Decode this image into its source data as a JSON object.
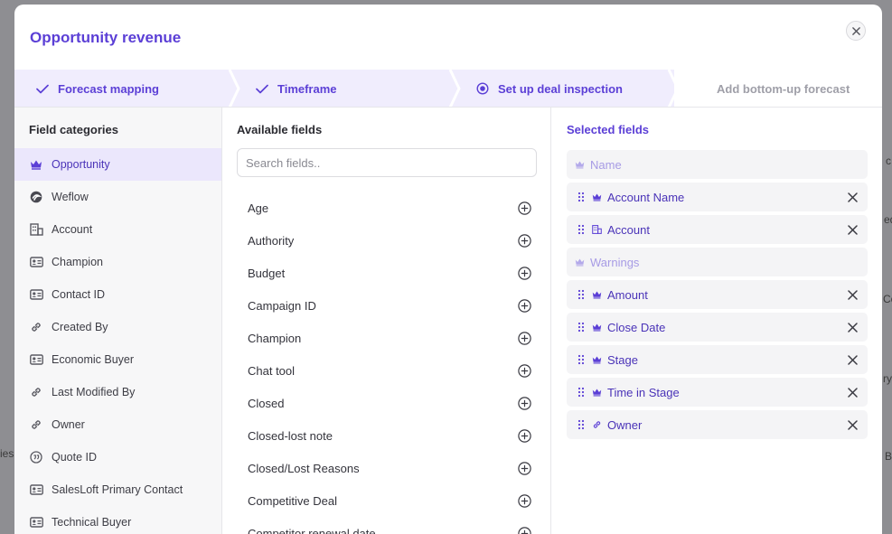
{
  "background": {
    "fragments": [
      "ies",
      "c",
      "ed",
      "Co",
      "ry,",
      "B"
    ]
  },
  "modal": {
    "title": "Opportunity revenue",
    "close_icon": "close-icon"
  },
  "stepper": {
    "steps": [
      {
        "label": "Forecast mapping",
        "state": "done",
        "icon": "check-icon"
      },
      {
        "label": "Timeframe",
        "state": "done",
        "icon": "check-icon"
      },
      {
        "label": "Set up deal inspection",
        "state": "current",
        "icon": "radio-dot-icon"
      },
      {
        "label": "Add bottom-up forecast",
        "state": "future",
        "icon": ""
      }
    ]
  },
  "categories": {
    "title": "Field categories",
    "items": [
      {
        "label": "Opportunity",
        "icon": "crown-icon",
        "active": true
      },
      {
        "label": "Weflow",
        "icon": "weflow-logo-icon"
      },
      {
        "label": "Account",
        "icon": "building-icon"
      },
      {
        "label": "Champion",
        "icon": "id-card-icon"
      },
      {
        "label": "Contact ID",
        "icon": "id-card-icon"
      },
      {
        "label": "Created By",
        "icon": "link-icon"
      },
      {
        "label": "Economic Buyer",
        "icon": "id-card-icon"
      },
      {
        "label": "Last Modified By",
        "icon": "link-icon"
      },
      {
        "label": "Owner",
        "icon": "link-icon"
      },
      {
        "label": "Quote ID",
        "icon": "quote-icon"
      },
      {
        "label": "SalesLoft Primary Contact",
        "icon": "id-card-icon"
      },
      {
        "label": "Technical Buyer",
        "icon": "id-card-icon"
      }
    ]
  },
  "available": {
    "title": "Available fields",
    "search_placeholder": "Search fields..",
    "items": [
      "Age",
      "Authority",
      "Budget",
      "Campaign ID",
      "Champion",
      "Chat tool",
      "Closed",
      "Closed-lost note",
      "Closed/Lost Reasons",
      "Competitive Deal",
      "Competitor renewal date"
    ]
  },
  "selected": {
    "title": "Selected fields",
    "items": [
      {
        "label": "Name",
        "icon": "crown-icon",
        "group": true
      },
      {
        "label": "Account Name",
        "icon": "crown-icon"
      },
      {
        "label": "Account",
        "icon": "building-icon"
      },
      {
        "label": "Warnings",
        "icon": "crown-icon",
        "group": true
      },
      {
        "label": "Amount",
        "icon": "crown-icon"
      },
      {
        "label": "Close Date",
        "icon": "crown-icon"
      },
      {
        "label": "Stage",
        "icon": "crown-icon"
      },
      {
        "label": "Time in Stage",
        "icon": "crown-icon"
      },
      {
        "label": "Owner",
        "icon": "link-icon"
      }
    ]
  },
  "colors": {
    "accent": "#5b3fd6",
    "accent_light": "#ebe7fc",
    "stepper_bg": "#f0edfd",
    "muted": "#9f9fa8"
  }
}
